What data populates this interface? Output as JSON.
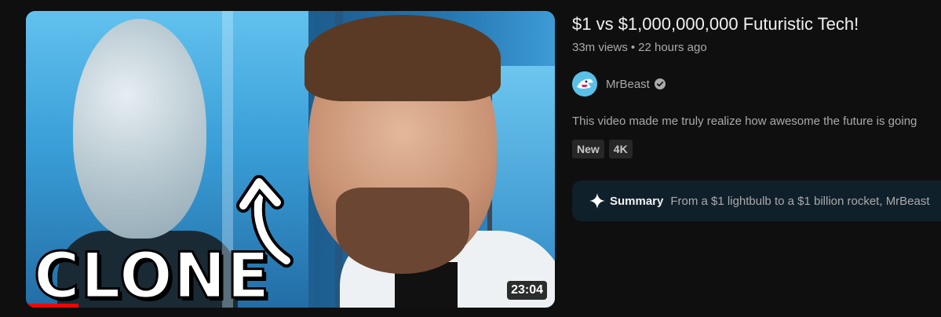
{
  "video": {
    "title": "$1 vs $1,000,000,000 Futuristic Tech!",
    "views": "33m views",
    "separator": "•",
    "age": "22 hours ago",
    "duration": "23:04",
    "thumbnail_text": "CLONE",
    "watched_fraction": 0.1
  },
  "channel": {
    "name": "MrBeast",
    "verified_icon": "verified-check-icon"
  },
  "description": "This video made me truly realize how awesome the future is going",
  "badges": [
    "New",
    "4K"
  ],
  "summary": {
    "label": "Summary",
    "text": "From a $1 lightbulb to a $1 billion rocket, MrBeast"
  },
  "colors": {
    "background": "#0f0f0f",
    "progress": "#ff0000",
    "summary_bg": "#10202b",
    "badge_bg": "#272727"
  }
}
